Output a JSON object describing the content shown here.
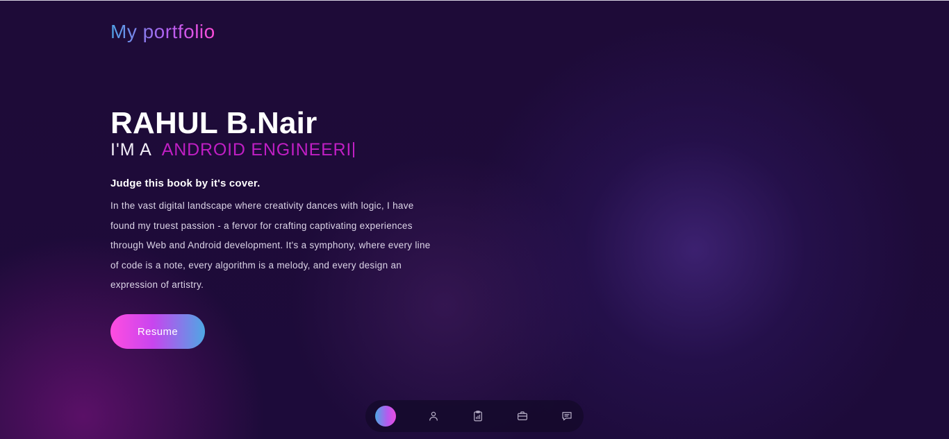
{
  "header": {
    "logo_text": "My portfolio"
  },
  "hero": {
    "name": "RAHUL B.Nair",
    "role_prefix": "I'M A",
    "role_typed": "ANDROID ENGINEERI",
    "tagline": "Judge this book by it's cover.",
    "description": "In the vast digital landscape where creativity dances with logic, I have found my truest passion - a fervor for crafting captivating experiences through Web and Android development. It's a symphony, where every line of code is a note, every algorithm is a melody, and every design an expression of artistry.",
    "resume_label": "Resume"
  },
  "dock": {
    "items": [
      {
        "icon": "home-icon",
        "active": true
      },
      {
        "icon": "user-icon",
        "active": false
      },
      {
        "icon": "clipboard-chart-icon",
        "active": false
      },
      {
        "icon": "briefcase-icon",
        "active": false
      },
      {
        "icon": "message-icon",
        "active": false
      }
    ]
  },
  "colors": {
    "background": "#1d0b3a",
    "accent_pink": "#ff4de0",
    "accent_blue": "#4ea7e4",
    "role_text": "#c01fc4"
  }
}
